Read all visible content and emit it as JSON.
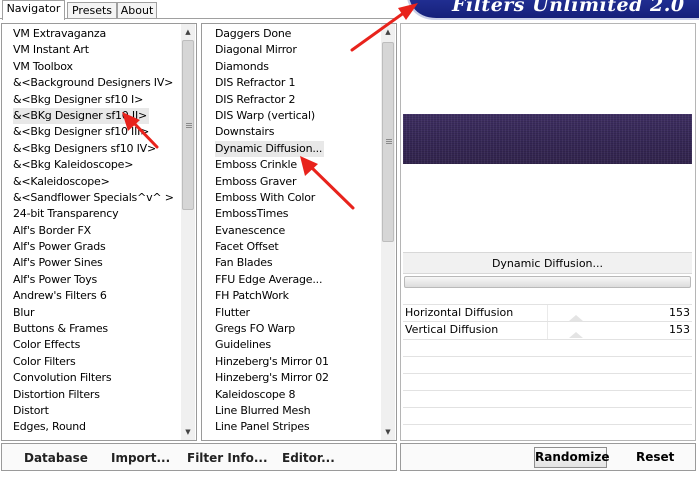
{
  "tabs": [
    "Navigator",
    "Presets",
    "About"
  ],
  "banner": "Filters Unlimited 2.0",
  "categories": [
    {
      "label": "VM Extravaganza"
    },
    {
      "label": "VM Instant Art"
    },
    {
      "label": "VM Toolbox"
    },
    {
      "label": "&<Background Designers IV>"
    },
    {
      "label": "&<Bkg Designer sf10 I>"
    },
    {
      "label": "&<BKg Designer sf10 II>",
      "selected": true
    },
    {
      "label": "&<Bkg Designer sf10 III>"
    },
    {
      "label": "&<Bkg Designers sf10 IV>"
    },
    {
      "label": "&<Bkg Kaleidoscope>"
    },
    {
      "label": "&<Kaleidoscope>"
    },
    {
      "label": "&<Sandflower Specials^v^ >"
    },
    {
      "label": "24-bit Transparency"
    },
    {
      "label": "Alf's Border FX"
    },
    {
      "label": "Alf's Power Grads"
    },
    {
      "label": "Alf's Power Sines"
    },
    {
      "label": "Alf's Power Toys"
    },
    {
      "label": "Andrew's Filters 6"
    },
    {
      "label": "Blur"
    },
    {
      "label": "Buttons & Frames"
    },
    {
      "label": "Color Effects"
    },
    {
      "label": "Color Filters"
    },
    {
      "label": "Convolution Filters"
    },
    {
      "label": "Distortion Filters"
    },
    {
      "label": "Distort"
    },
    {
      "label": "Edges, Round"
    }
  ],
  "filters": [
    {
      "label": "Daggers Done"
    },
    {
      "label": "Diagonal Mirror"
    },
    {
      "label": "Diamonds"
    },
    {
      "label": "DIS Refractor 1"
    },
    {
      "label": "DIS Refractor 2",
      "marked": true
    },
    {
      "label": "DIS Warp (vertical)"
    },
    {
      "label": "Downstairs"
    },
    {
      "label": "Dynamic Diffusion...",
      "selected": true
    },
    {
      "label": "Emboss Crinkle"
    },
    {
      "label": "Emboss Graver"
    },
    {
      "label": "Emboss With Color"
    },
    {
      "label": "EmbossTimes"
    },
    {
      "label": "Evanescence"
    },
    {
      "label": "Facet Offset"
    },
    {
      "label": "Fan Blades"
    },
    {
      "label": "FFU Edge Average..."
    },
    {
      "label": "FH PatchWork"
    },
    {
      "label": "Flutter",
      "marked": true
    },
    {
      "label": "Gregs FO Warp"
    },
    {
      "label": "Guidelines",
      "marked": true
    },
    {
      "label": "Hinzeberg's Mirror 01"
    },
    {
      "label": "Hinzeberg's Mirror 02"
    },
    {
      "label": "Kaleidoscope 8"
    },
    {
      "label": "Line Blurred Mesh"
    },
    {
      "label": "Line Panel Stripes"
    }
  ],
  "bottom_buttons": [
    "Database",
    "Import...",
    "Filter Info...",
    "Editor..."
  ],
  "filter_name": "Dynamic Diffusion...",
  "params": [
    {
      "label": "Horizontal Diffusion",
      "value": "153"
    },
    {
      "label": "Vertical Diffusion",
      "value": "153"
    }
  ],
  "randomize_label": "Randomize",
  "reset_label": "Reset",
  "colors": {
    "preview": "#3a2b5c",
    "arrow": "#e8231c",
    "banner": "#1c2a8f"
  }
}
